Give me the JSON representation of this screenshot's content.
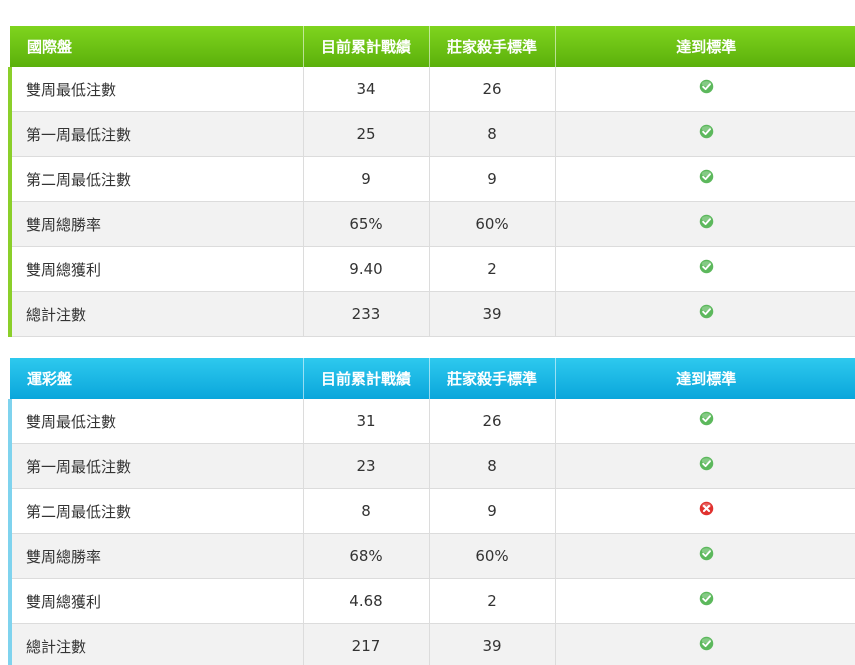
{
  "tables": [
    {
      "title": "國際盤",
      "columns": [
        "目前累計戰績",
        "莊家殺手標準",
        "達到標準"
      ],
      "rows": [
        {
          "label": "雙周最低注數",
          "current": "34",
          "standard": "26",
          "status": "pass"
        },
        {
          "label": "第一周最低注數",
          "current": "25",
          "standard": "8",
          "status": "pass"
        },
        {
          "label": "第二周最低注數",
          "current": "9",
          "standard": "9",
          "status": "pass"
        },
        {
          "label": "雙周總勝率",
          "current": "65%",
          "standard": "60%",
          "status": "pass"
        },
        {
          "label": "雙周總獲利",
          "current": "9.40",
          "standard": "2",
          "status": "pass"
        },
        {
          "label": "總計注數",
          "current": "233",
          "standard": "39",
          "status": "pass"
        }
      ]
    },
    {
      "title": "運彩盤",
      "columns": [
        "目前累計戰績",
        "莊家殺手標準",
        "達到標準"
      ],
      "rows": [
        {
          "label": "雙周最低注數",
          "current": "31",
          "standard": "26",
          "status": "pass"
        },
        {
          "label": "第一周最低注數",
          "current": "23",
          "standard": "8",
          "status": "pass"
        },
        {
          "label": "第二周最低注數",
          "current": "8",
          "standard": "9",
          "status": "fail"
        },
        {
          "label": "雙周總勝率",
          "current": "68%",
          "standard": "60%",
          "status": "pass"
        },
        {
          "label": "雙周總獲利",
          "current": "4.68",
          "standard": "2",
          "status": "pass"
        },
        {
          "label": "總計注數",
          "current": "217",
          "standard": "39",
          "status": "pass"
        }
      ]
    }
  ],
  "icons": {
    "pass": "check-circle-icon",
    "fail": "x-circle-icon"
  },
  "colors": {
    "intl_header": "#6cc214",
    "lottery_header": "#18b5e5",
    "pass": "#5cb85c",
    "fail": "#e0312e"
  }
}
